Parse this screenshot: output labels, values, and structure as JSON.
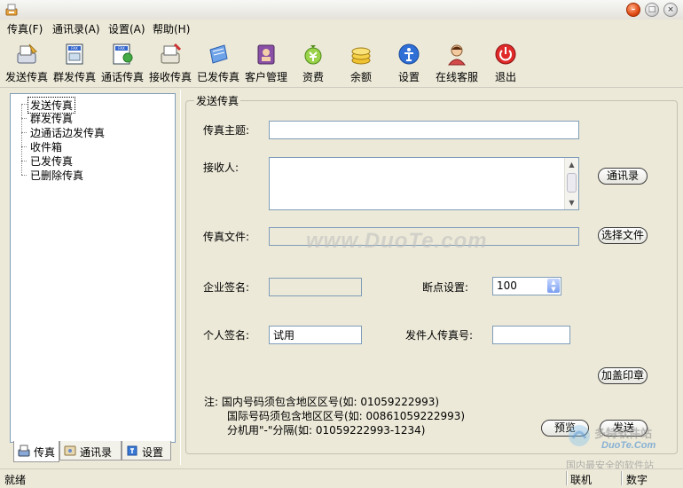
{
  "menu": [
    "传真(F)",
    "通讯录(A)",
    "设置(A)",
    "帮助(H)"
  ],
  "toolbar": [
    {
      "label": "发送传真",
      "icon": "fax-send-icon"
    },
    {
      "label": "群发传真",
      "icon": "fax-group-icon"
    },
    {
      "label": "通话传真",
      "icon": "fax-call-icon"
    },
    {
      "label": "接收传真",
      "icon": "fax-receive-icon"
    },
    {
      "label": "已发传真",
      "icon": "sent-fax-icon"
    },
    {
      "label": "客户管理",
      "icon": "customer-book-icon"
    },
    {
      "label": "资费",
      "icon": "tariff-icon"
    },
    {
      "label": "余额",
      "icon": "coins-icon"
    },
    {
      "label": "设置",
      "icon": "settings-icon"
    },
    {
      "label": "在线客服",
      "icon": "support-person-icon"
    },
    {
      "label": "退出",
      "icon": "power-icon"
    }
  ],
  "tree": [
    "发送传真",
    "群发传真",
    "边通话边发传真",
    "收件箱",
    "已发传真",
    "已删除传真"
  ],
  "left_tabs": [
    "传真",
    "通讯录",
    "设置"
  ],
  "form": {
    "group_title": "发送传真",
    "subject_label": "传真主题:",
    "subject_value": "",
    "recipient_label": "接收人:",
    "address_book_button": "通讯录",
    "file_label": "传真文件:",
    "choose_file_button": "选择文件",
    "company_sign_label": "企业签名:",
    "company_sign_value": "",
    "breakpoint_label": "断点设置:",
    "breakpoint_value": "100",
    "personal_sign_label": "个人签名:",
    "personal_sign_value": "试用",
    "sender_fax_label": "发件人传真号:",
    "sender_fax_value": "",
    "stamp_button": "加盖印章",
    "notes": [
      "注: 国内号码须包含地区区号(如: 01059222993)",
      "国际号码须包含地区区号(如: 00861059222993)",
      "分机用\"-\"分隔(如: 01059222993-1234)"
    ],
    "preview_button": "预览",
    "send_button": "发送"
  },
  "watermark": "www.DuoTe.com",
  "corner_watermark": {
    "line1": "多特软件站",
    "line2": "DuoTe.Com",
    "line3": "国内最安全的软件站"
  },
  "status": {
    "left": "就绪",
    "online": "联机",
    "numlock": "数字"
  },
  "colors": {
    "window_bg": "#ece9d8",
    "input_border": "#7f9db9",
    "close_red": "#e04a14",
    "select_blue": "#7a9ef0"
  }
}
